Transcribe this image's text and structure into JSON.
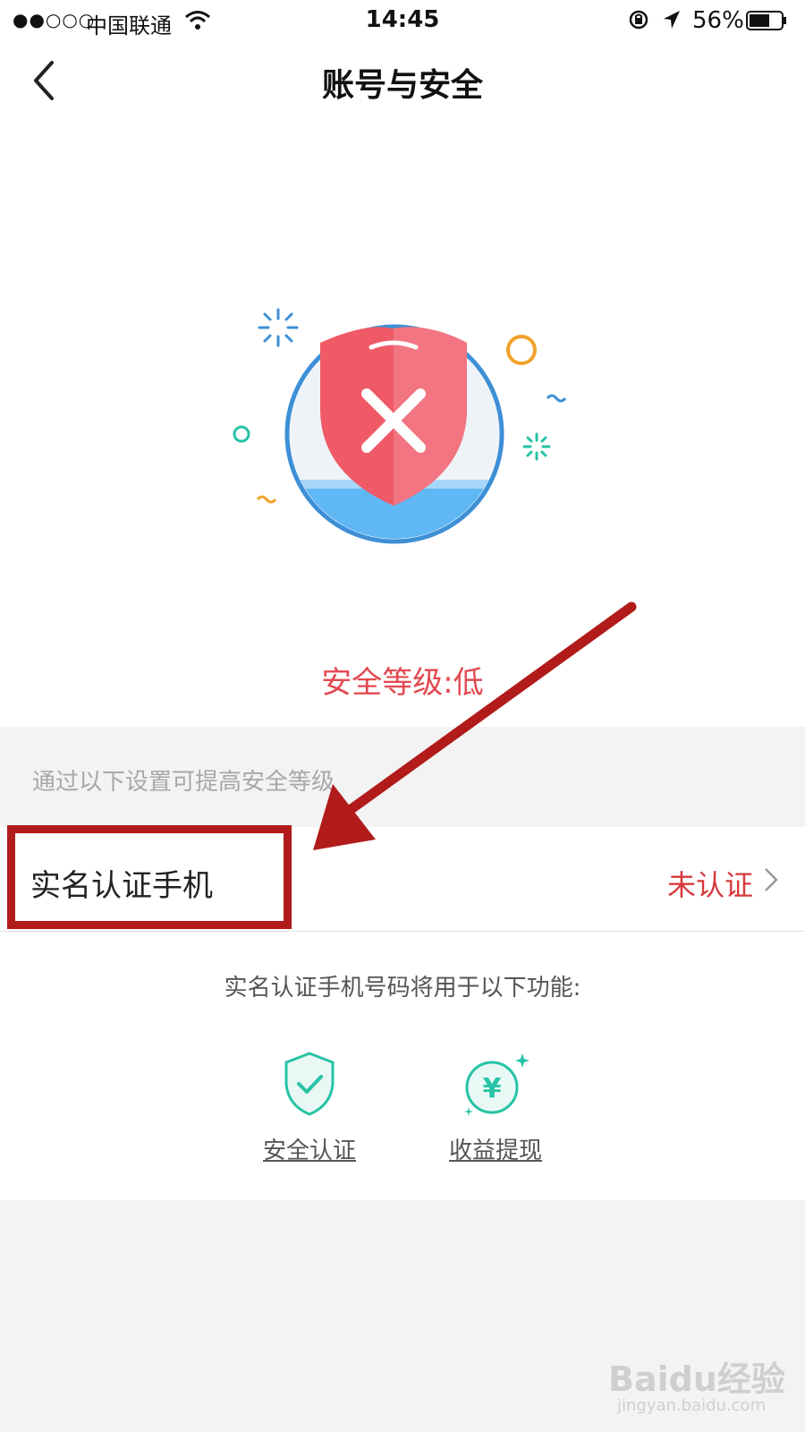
{
  "status_bar": {
    "signal": "●●○○○",
    "carrier": "中国联通",
    "time": "14:45",
    "battery_percent": "56%"
  },
  "nav": {
    "title": "账号与安全"
  },
  "security": {
    "level_text": "安全等级:低"
  },
  "hint": {
    "text": "通过以下设置可提高安全等级"
  },
  "row": {
    "label": "实名认证手机",
    "status": "未认证"
  },
  "features": {
    "caption": "实名认证手机号码将用于以下功能:",
    "items": [
      {
        "label": "安全认证",
        "icon": "shield-check-icon"
      },
      {
        "label": "收益提现",
        "icon": "yuan-coin-icon"
      }
    ]
  },
  "watermark": {
    "brand": "Baidu经验",
    "url": "jingyan.baidu.com"
  },
  "colors": {
    "danger": "#e34850",
    "annotation": "#b11b1a",
    "teal": "#27c3a6",
    "shield": "#ef5a66"
  }
}
